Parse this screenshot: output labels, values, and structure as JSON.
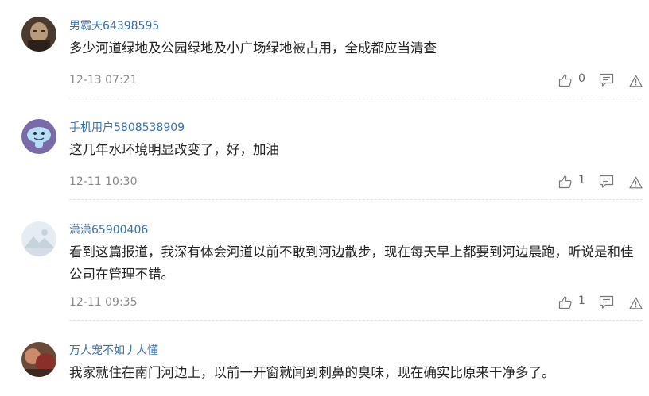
{
  "comments": [
    {
      "username": "男霸天64398595",
      "text": "多少河道绿地及公园绿地及小广场绿地被占用，全成都应当清查",
      "time": "12-13 07:21",
      "likes": "0",
      "avatar_icon": "avatar-dark-portrait"
    },
    {
      "username": "手机用户5808538909",
      "text": "这几年水环境明显改变了，好，加油",
      "time": "12-11 10:30",
      "likes": "1",
      "avatar_icon": "avatar-purple-mushroom"
    },
    {
      "username": "潇潇65900406",
      "text": "看到这篇报道，我深有体会河道以前不敢到河边散步，现在每天早上都要到河边晨跑，听说是和佳公司在管理不错。",
      "time": "12-11 09:35",
      "likes": "1",
      "avatar_icon": "avatar-default-mountain"
    },
    {
      "username": "万人宠不如丿人懂",
      "text": "我家就住在南门河边上，以前一开窗就闻到刺鼻的臭味，现在确实比原来干净多了。",
      "avatar_icon": "avatar-photo"
    }
  ],
  "icons": {
    "like": "thumbs-up-icon",
    "reply": "comment-icon",
    "report": "warning-icon"
  },
  "colors": {
    "username": "#3a70a8",
    "text": "#222222",
    "meta": "#8a8a8a"
  }
}
